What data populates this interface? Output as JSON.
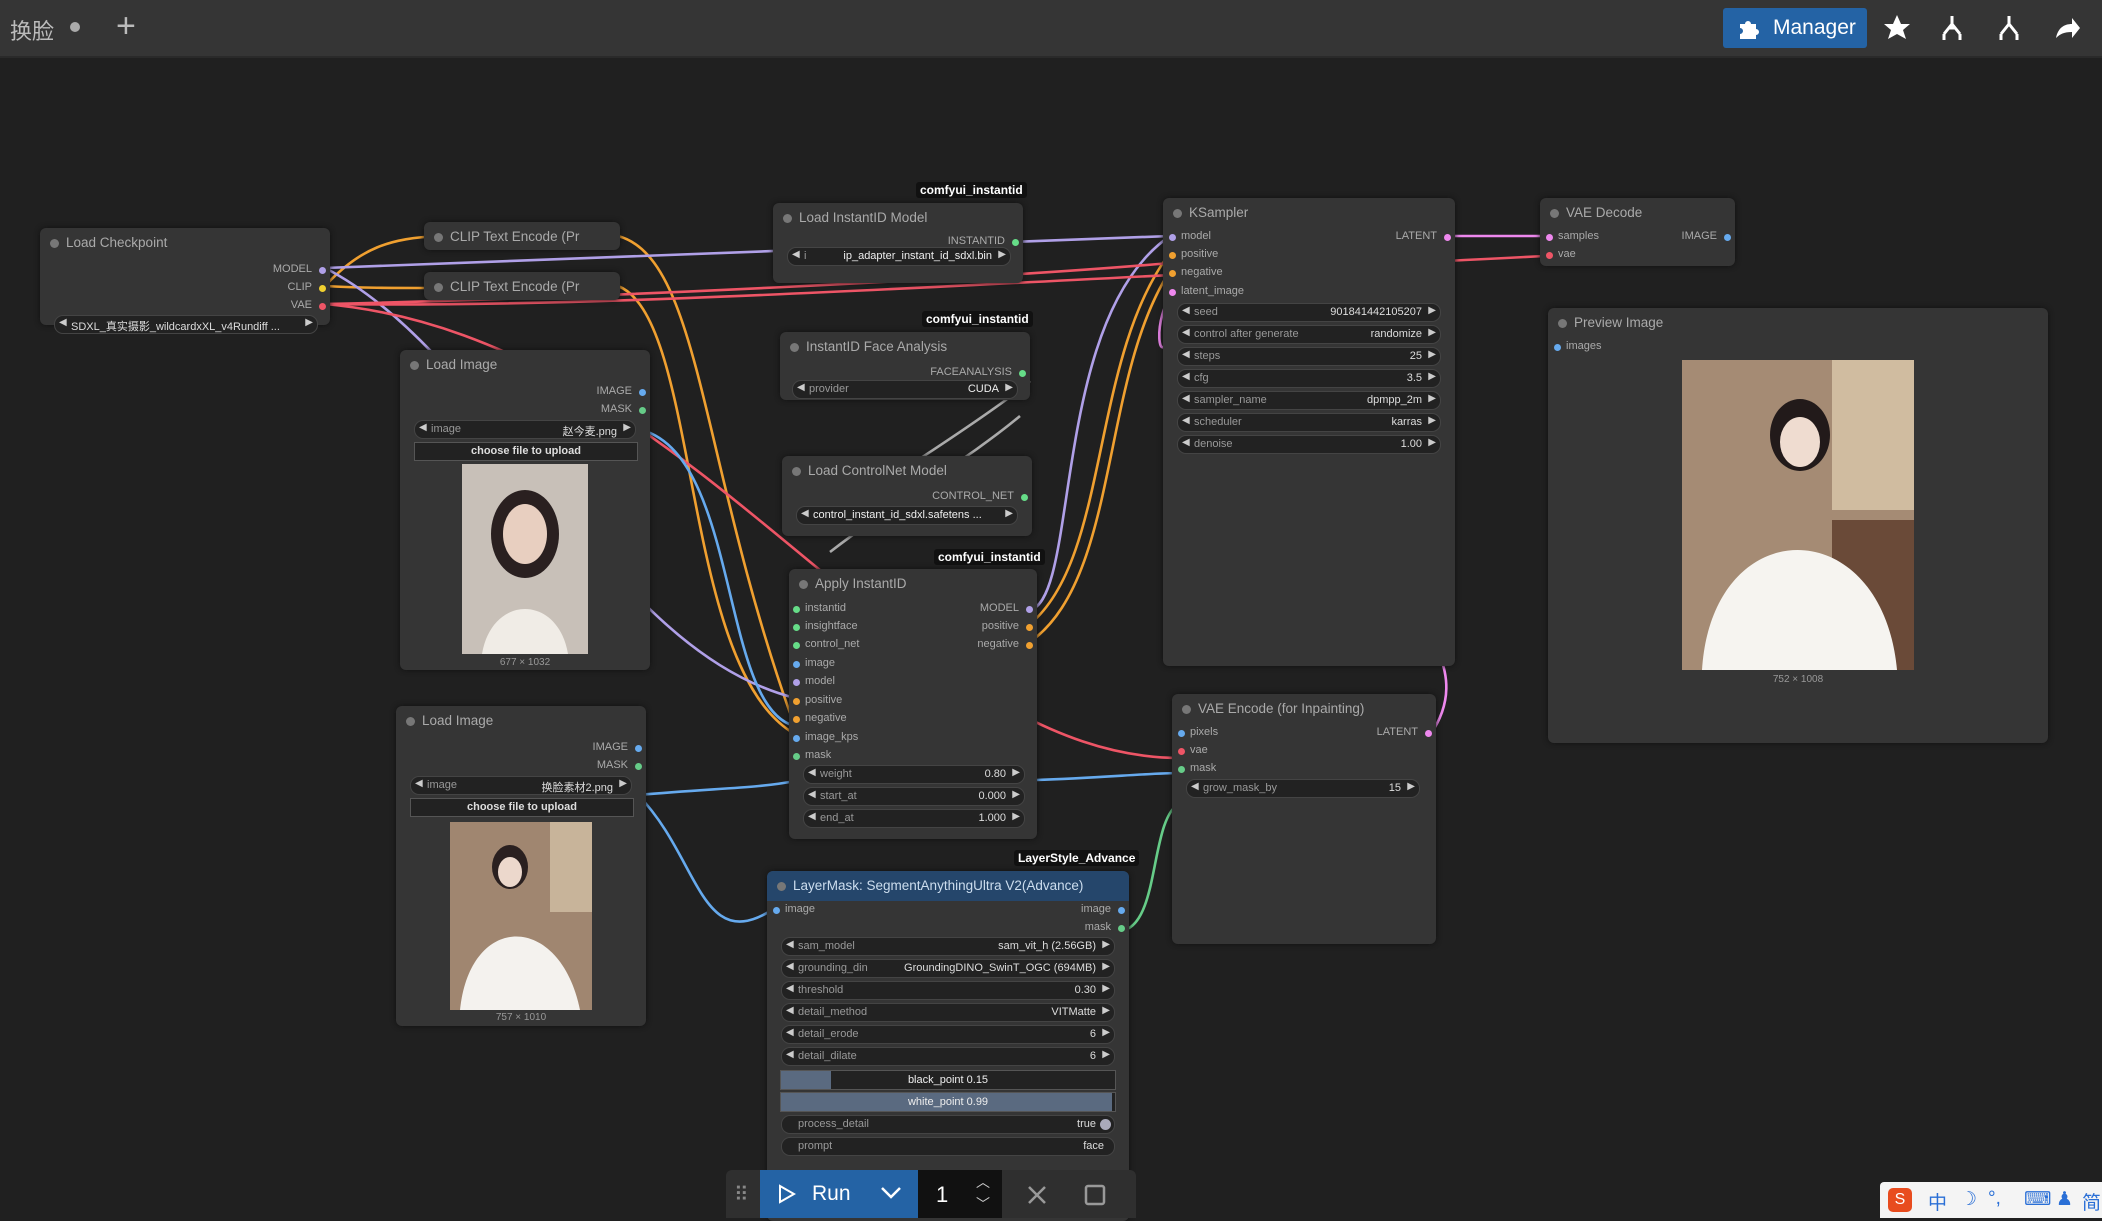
{
  "topbar": {
    "tab_title": "换脸",
    "new_tab": "+",
    "manager_label": "Manager",
    "icons": [
      "puzzle-icon",
      "star-icon",
      "fork-icon",
      "fork-alt-icon",
      "share-icon"
    ]
  },
  "nodes": {
    "load_checkpoint": {
      "title": "Load Checkpoint",
      "outputs": [
        "MODEL",
        "CLIP",
        "VAE"
      ],
      "ckpt": "SDXL_真实摄影_wildcardxXL_v4Rundiff ..."
    },
    "clip1": {
      "title": "CLIP Text Encode (Pr"
    },
    "clip2": {
      "title": "CLIP Text Encode (Pr"
    },
    "load_image1": {
      "title": "Load Image",
      "outputs": [
        "IMAGE",
        "MASK"
      ],
      "image_label": "image",
      "image_value": "赵今麦.png",
      "upload": "choose file to upload",
      "dims": "677 × 1032"
    },
    "load_image2": {
      "title": "Load Image",
      "outputs": [
        "IMAGE",
        "MASK"
      ],
      "image_label": "image",
      "image_value": "换脸素材2.png",
      "upload": "choose file to upload",
      "dims": "757 × 1010"
    },
    "instantid_model": {
      "badge": "comfyui_instantid",
      "title": "Load InstantID Model",
      "output": "INSTANTID",
      "file": "ip_adapter_instant_id_sdxl.bin",
      "prefix": "i"
    },
    "face_analysis": {
      "badge": "comfyui_instantid",
      "title": "InstantID Face Analysis",
      "output": "FACEANALYSIS",
      "provider_label": "provider",
      "provider_value": "CUDA"
    },
    "controlnet": {
      "title": "Load ControlNet Model",
      "output": "CONTROL_NET",
      "file": "control_instant_id_sdxl.safetens ..."
    },
    "apply_instantid": {
      "badge": "comfyui_instantid",
      "title": "Apply InstantID",
      "inputs": [
        "instantid",
        "insightface",
        "control_net",
        "image",
        "model",
        "positive",
        "negative",
        "image_kps",
        "mask"
      ],
      "outputs": [
        "MODEL",
        "positive",
        "negative"
      ],
      "widgets": [
        {
          "label": "weight",
          "value": "0.80"
        },
        {
          "label": "start_at",
          "value": "0.000"
        },
        {
          "label": "end_at",
          "value": "1.000"
        }
      ]
    },
    "ksampler": {
      "title": "KSampler",
      "inputs": [
        "model",
        "positive",
        "negative",
        "latent_image"
      ],
      "output": "LATENT",
      "widgets": [
        {
          "label": "seed",
          "value": "901841442105207"
        },
        {
          "label": "control after generate",
          "value": "randomize"
        },
        {
          "label": "steps",
          "value": "25"
        },
        {
          "label": "cfg",
          "value": "3.5"
        },
        {
          "label": "sampler_name",
          "value": "dpmpp_2m"
        },
        {
          "label": "scheduler",
          "value": "karras"
        },
        {
          "label": "denoise",
          "value": "1.00"
        }
      ]
    },
    "vae_decode": {
      "title": "VAE Decode",
      "inputs": [
        "samples",
        "vae"
      ],
      "output": "IMAGE"
    },
    "preview": {
      "title": "Preview Image",
      "input": "images",
      "dims": "752 × 1008"
    },
    "vae_encode": {
      "title": "VAE Encode (for Inpainting)",
      "inputs": [
        "pixels",
        "vae",
        "mask"
      ],
      "output": "LATENT",
      "grow_label": "grow_mask_by",
      "grow_value": "15"
    },
    "layermask": {
      "badge": "LayerStyle_Advance",
      "title": "LayerMask: SegmentAnythingUltra V2(Advance)",
      "input": "image",
      "outputs": [
        "image",
        "mask"
      ],
      "widgets": [
        {
          "label": "sam_model",
          "value": "sam_vit_h (2.56GB)"
        },
        {
          "label": "grounding_din",
          "value": "GroundingDINO_SwinT_OGC (694MB)"
        },
        {
          "label": "threshold",
          "value": "0.30"
        },
        {
          "label": "detail_method",
          "value": "VITMatte"
        },
        {
          "label": "detail_erode",
          "value": "6"
        },
        {
          "label": "detail_dilate",
          "value": "6"
        }
      ],
      "black_point": "black_point  0.15",
      "white_point": "white_point  0.99",
      "process_label": "process_detail",
      "process_value": "true",
      "prompt_label": "prompt",
      "prompt_value": "face",
      "black_point_fill": 0.15,
      "white_point_fill": 0.99
    }
  },
  "runbar": {
    "run_label": "Run",
    "count": "1"
  },
  "ime": {
    "items": [
      "中",
      "☽",
      "°,",
      "⌨",
      "♟",
      "简"
    ]
  }
}
